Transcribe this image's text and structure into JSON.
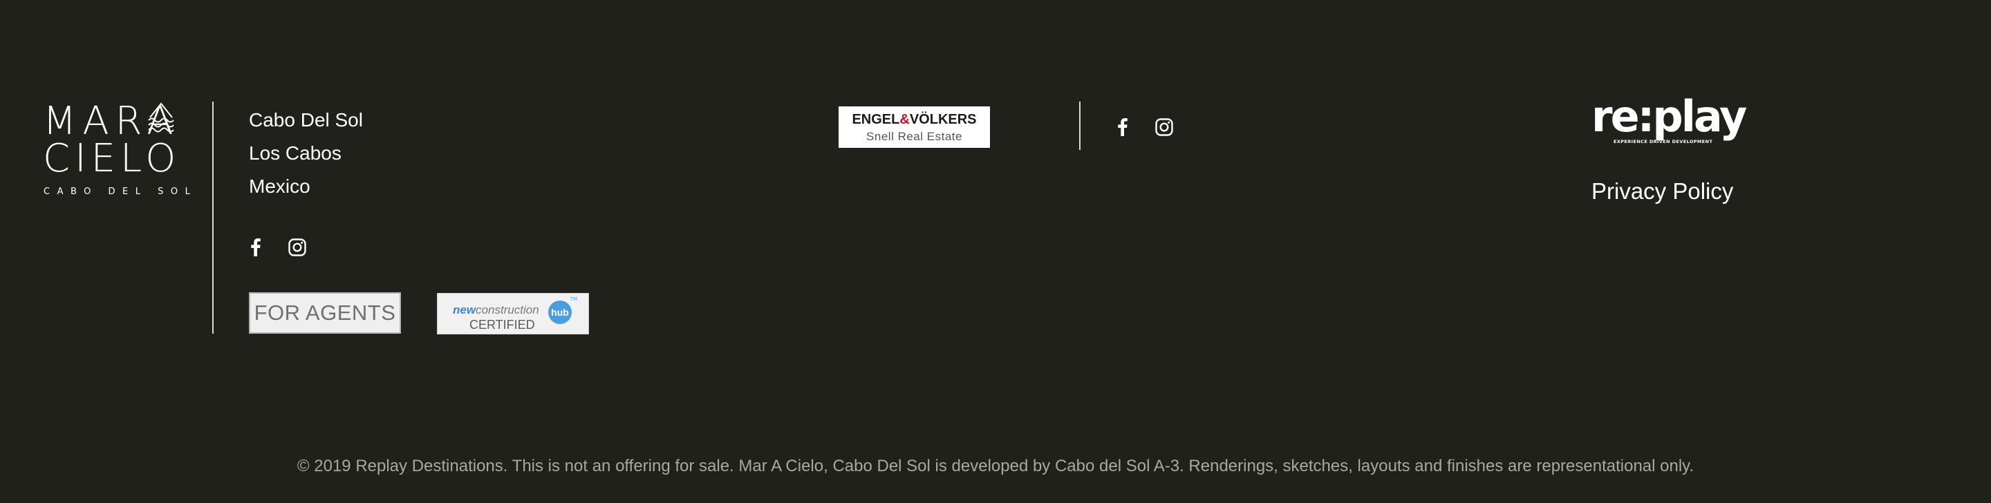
{
  "brand": {
    "logo_line1": "MARA",
    "logo_line2": "CIELO",
    "logo_sub": "CABO DEL SOL"
  },
  "address": {
    "line1": "Cabo Del Sol",
    "line2": "Los Cabos",
    "line3": "Mexico"
  },
  "social": {
    "icons": [
      "facebook-icon",
      "instagram-icon"
    ]
  },
  "badges": {
    "agents_label": "FOR AGENTS",
    "nch_new": "new",
    "nch_construction": "construction",
    "nch_certified": "CERTIFIED",
    "nch_hub": "hub",
    "nch_tm": "TM"
  },
  "partner": {
    "name_left": "ENGEL",
    "name_amp": "&",
    "name_right": "VÖLKERS",
    "sub": "Snell Real Estate"
  },
  "developer": {
    "logo_word": "re:play",
    "logo_tag": "EXPERIENCE  DRIVEN  DEVELOPMENT"
  },
  "links": {
    "privacy": "Privacy Policy"
  },
  "footer": {
    "copyright": "© 2019 Replay Destinations. This is not an offering for sale. Mar A Cielo, Cabo Del Sol is developed by Cabo del Sol A-3. Renderings, sketches, layouts and finishes are representational only."
  },
  "colors": {
    "background": "#21211c",
    "text": "#ffffff",
    "muted_text": "#a9a9a3",
    "ev_red": "#c8102e",
    "hub_blue": "#4a9ee0"
  }
}
